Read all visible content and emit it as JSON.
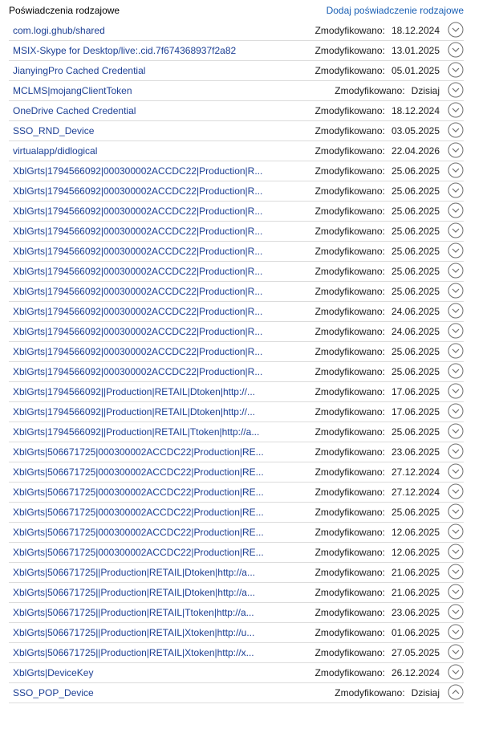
{
  "header": {
    "title": "Poświadczenia rodzajowe",
    "add_link": "Dodaj poświadczenie rodzajowe"
  },
  "modified_label": "Zmodyfikowano:",
  "credentials": [
    {
      "name": "com.logi.ghub/shared",
      "date": "18.12.2024",
      "expanded": false
    },
    {
      "name": "MSIX-Skype for Desktop/live:.cid.7f674368937f2a82",
      "date": "13.01.2025",
      "expanded": false
    },
    {
      "name": "JianyingPro Cached Credential",
      "date": "05.01.2025",
      "expanded": false
    },
    {
      "name": "MCLMS|mojangClientToken",
      "date": "Dzisiaj",
      "expanded": false
    },
    {
      "name": "OneDrive Cached Credential",
      "date": "18.12.2024",
      "expanded": false
    },
    {
      "name": "SSO_RND_Device",
      "date": "03.05.2025",
      "expanded": false
    },
    {
      "name": "virtualapp/didlogical",
      "date": "22.04.2026",
      "expanded": false
    },
    {
      "name": "XblGrts|1794566092|000300002ACCDC22|Production|R...",
      "date": "25.06.2025",
      "expanded": false
    },
    {
      "name": "XblGrts|1794566092|000300002ACCDC22|Production|R...",
      "date": "25.06.2025",
      "expanded": false
    },
    {
      "name": "XblGrts|1794566092|000300002ACCDC22|Production|R...",
      "date": "25.06.2025",
      "expanded": false
    },
    {
      "name": "XblGrts|1794566092|000300002ACCDC22|Production|R...",
      "date": "25.06.2025",
      "expanded": false
    },
    {
      "name": "XblGrts|1794566092|000300002ACCDC22|Production|R...",
      "date": "25.06.2025",
      "expanded": false
    },
    {
      "name": "XblGrts|1794566092|000300002ACCDC22|Production|R...",
      "date": "25.06.2025",
      "expanded": false
    },
    {
      "name": "XblGrts|1794566092|000300002ACCDC22|Production|R...",
      "date": "25.06.2025",
      "expanded": false
    },
    {
      "name": "XblGrts|1794566092|000300002ACCDC22|Production|R...",
      "date": "24.06.2025",
      "expanded": false
    },
    {
      "name": "XblGrts|1794566092|000300002ACCDC22|Production|R...",
      "date": "24.06.2025",
      "expanded": false
    },
    {
      "name": "XblGrts|1794566092|000300002ACCDC22|Production|R...",
      "date": "25.06.2025",
      "expanded": false
    },
    {
      "name": "XblGrts|1794566092|000300002ACCDC22|Production|R...",
      "date": "25.06.2025",
      "expanded": false
    },
    {
      "name": "XblGrts|1794566092||Production|RETAIL|Dtoken|http://...",
      "date": "17.06.2025",
      "expanded": false
    },
    {
      "name": "XblGrts|1794566092||Production|RETAIL|Dtoken|http://...",
      "date": "17.06.2025",
      "expanded": false
    },
    {
      "name": "XblGrts|1794566092||Production|RETAIL|Ttoken|http://a...",
      "date": "25.06.2025",
      "expanded": false
    },
    {
      "name": "XblGrts|506671725|000300002ACCDC22|Production|RE...",
      "date": "23.06.2025",
      "expanded": false
    },
    {
      "name": "XblGrts|506671725|000300002ACCDC22|Production|RE...",
      "date": "27.12.2024",
      "expanded": false
    },
    {
      "name": "XblGrts|506671725|000300002ACCDC22|Production|RE...",
      "date": "27.12.2024",
      "expanded": false
    },
    {
      "name": "XblGrts|506671725|000300002ACCDC22|Production|RE...",
      "date": "25.06.2025",
      "expanded": false
    },
    {
      "name": "XblGrts|506671725|000300002ACCDC22|Production|RE...",
      "date": "12.06.2025",
      "expanded": false
    },
    {
      "name": "XblGrts|506671725|000300002ACCDC22|Production|RE...",
      "date": "12.06.2025",
      "expanded": false
    },
    {
      "name": "XblGrts|506671725||Production|RETAIL|Dtoken|http://a...",
      "date": "21.06.2025",
      "expanded": false
    },
    {
      "name": "XblGrts|506671725||Production|RETAIL|Dtoken|http://a...",
      "date": "21.06.2025",
      "expanded": false
    },
    {
      "name": "XblGrts|506671725||Production|RETAIL|Ttoken|http://a...",
      "date": "23.06.2025",
      "expanded": false
    },
    {
      "name": "XblGrts|506671725||Production|RETAIL|Xtoken|http://u...",
      "date": "01.06.2025",
      "expanded": false
    },
    {
      "name": "XblGrts|506671725||Production|RETAIL|Xtoken|http://x...",
      "date": "27.05.2025",
      "expanded": false
    },
    {
      "name": "XblGrts|DeviceKey",
      "date": "26.12.2024",
      "expanded": false
    },
    {
      "name": "SSO_POP_Device",
      "date": "Dzisiaj",
      "expanded": true
    }
  ],
  "icons": {
    "collapsed": "chevron-down-circle-icon",
    "expanded": "chevron-up-circle-icon"
  },
  "colors": {
    "link": "#1c3f94",
    "header_link": "#1a5fb4",
    "divider": "#dcdcdc",
    "icon": "#6e6e6e"
  }
}
